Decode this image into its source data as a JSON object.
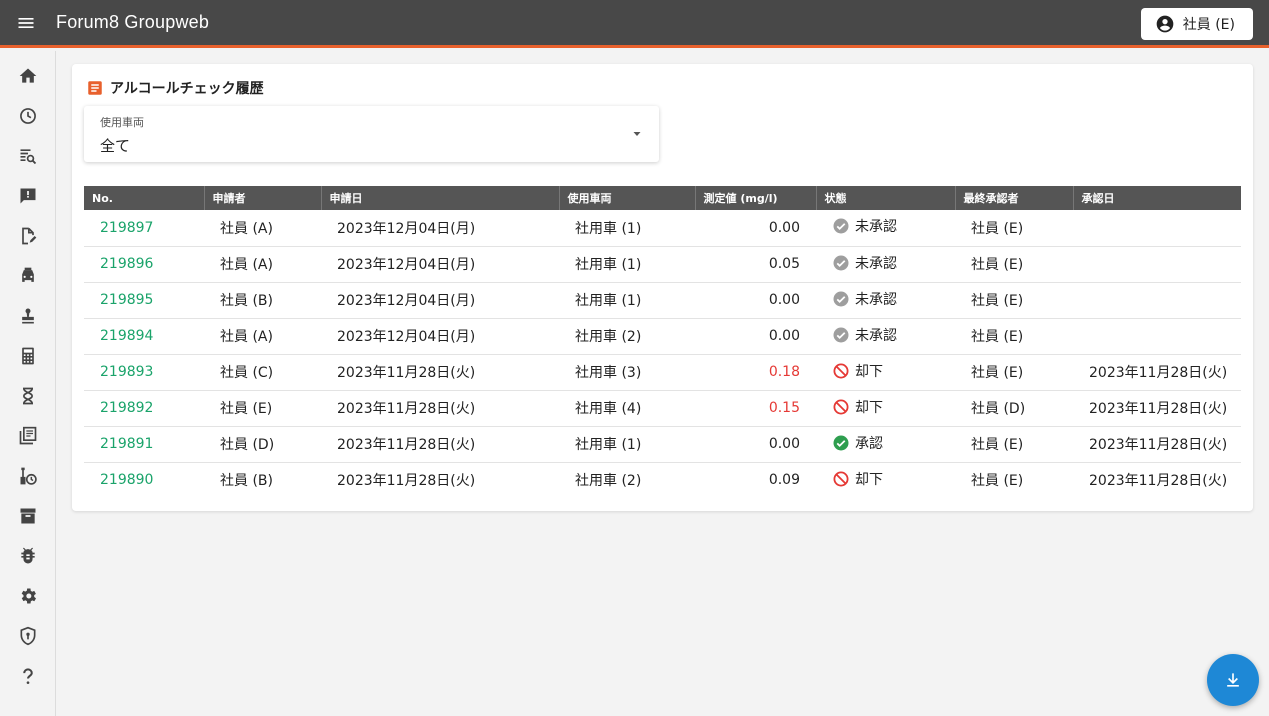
{
  "app": {
    "title": "Forum8 Groupweb",
    "user_label": "社員 (E)",
    "accent": "#e8602c"
  },
  "sidebar": {
    "icons": [
      "home-icon",
      "history-icon",
      "search-doc-icon",
      "feedback-icon",
      "edit-doc-icon",
      "vehicle-icon",
      "stamp-icon",
      "calculator-icon",
      "hourglass-icon",
      "library-icon",
      "tools-icon",
      "archive-icon",
      "bug-icon",
      "settings-icon",
      "security-icon",
      "help-icon"
    ]
  },
  "page": {
    "title": "アルコールチェック履歴"
  },
  "filter": {
    "label": "使用車両",
    "value": "全て"
  },
  "table": {
    "headers": [
      "No.",
      "申請者",
      "申請日",
      "使用車両",
      "測定値 (mg/l)",
      "状態",
      "最終承認者",
      "承認日"
    ],
    "rows": [
      {
        "id": "219897",
        "applicant": "社員 (A)",
        "date": "2023年12月04日(月)",
        "vehicle": "社用車 (1)",
        "value": "0.00",
        "status": "未承認",
        "status_type": "pending",
        "approver": "社員 (E)",
        "approved_date": "",
        "high": false
      },
      {
        "id": "219896",
        "applicant": "社員 (A)",
        "date": "2023年12月04日(月)",
        "vehicle": "社用車 (1)",
        "value": "0.05",
        "status": "未承認",
        "status_type": "pending",
        "approver": "社員 (E)",
        "approved_date": "",
        "high": false
      },
      {
        "id": "219895",
        "applicant": "社員 (B)",
        "date": "2023年12月04日(月)",
        "vehicle": "社用車 (1)",
        "value": "0.00",
        "status": "未承認",
        "status_type": "pending",
        "approver": "社員 (E)",
        "approved_date": "",
        "high": false
      },
      {
        "id": "219894",
        "applicant": "社員 (A)",
        "date": "2023年12月04日(月)",
        "vehicle": "社用車 (2)",
        "value": "0.00",
        "status": "未承認",
        "status_type": "pending",
        "approver": "社員 (E)",
        "approved_date": "",
        "high": false
      },
      {
        "id": "219893",
        "applicant": "社員 (C)",
        "date": "2023年11月28日(火)",
        "vehicle": "社用車 (3)",
        "value": "0.18",
        "status": "却下",
        "status_type": "rejected",
        "approver": "社員 (E)",
        "approved_date": "2023年11月28日(火)",
        "high": true
      },
      {
        "id": "219892",
        "applicant": "社員 (E)",
        "date": "2023年11月28日(火)",
        "vehicle": "社用車 (4)",
        "value": "0.15",
        "status": "却下",
        "status_type": "rejected",
        "approver": "社員 (D)",
        "approved_date": "2023年11月28日(火)",
        "high": true
      },
      {
        "id": "219891",
        "applicant": "社員 (D)",
        "date": "2023年11月28日(火)",
        "vehicle": "社用車 (1)",
        "value": "0.00",
        "status": "承認",
        "status_type": "approved",
        "approver": "社員 (E)",
        "approved_date": "2023年11月28日(火)",
        "high": false
      },
      {
        "id": "219890",
        "applicant": "社員 (B)",
        "date": "2023年11月28日(火)",
        "vehicle": "社用車 (2)",
        "value": "0.09",
        "status": "却下",
        "status_type": "rejected",
        "approver": "社員 (E)",
        "approved_date": "2023年11月28日(火)",
        "high": false
      }
    ]
  },
  "colors": {
    "link": "#1aa36a",
    "high_value": "#e53935",
    "approved": "#2e9e4f",
    "rejected": "#e53935",
    "pending": "#9e9e9e",
    "fab": "#1e88d6"
  },
  "fab": {
    "icon": "download-icon"
  }
}
